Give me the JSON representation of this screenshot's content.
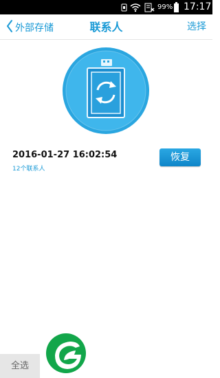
{
  "status_bar": {
    "battery_percent": "99%",
    "time": "17:17"
  },
  "header": {
    "back_label": "外部存储",
    "title": "联系人",
    "select_label": "选择"
  },
  "backup_record": {
    "datetime": "2016-01-27 16:02:54",
    "count_label": "12个联系人",
    "restore_label": "恢复"
  },
  "footer": {
    "select_all_label": "全选"
  },
  "colors": {
    "accent": "#1a9ad6",
    "hero_ring": "#2aa6e0",
    "logo_green": "#12a64a"
  },
  "icons": {
    "back": "chevron-left-icon",
    "hero": "storage-sync-icon",
    "logo": "green-leaf-logo"
  }
}
